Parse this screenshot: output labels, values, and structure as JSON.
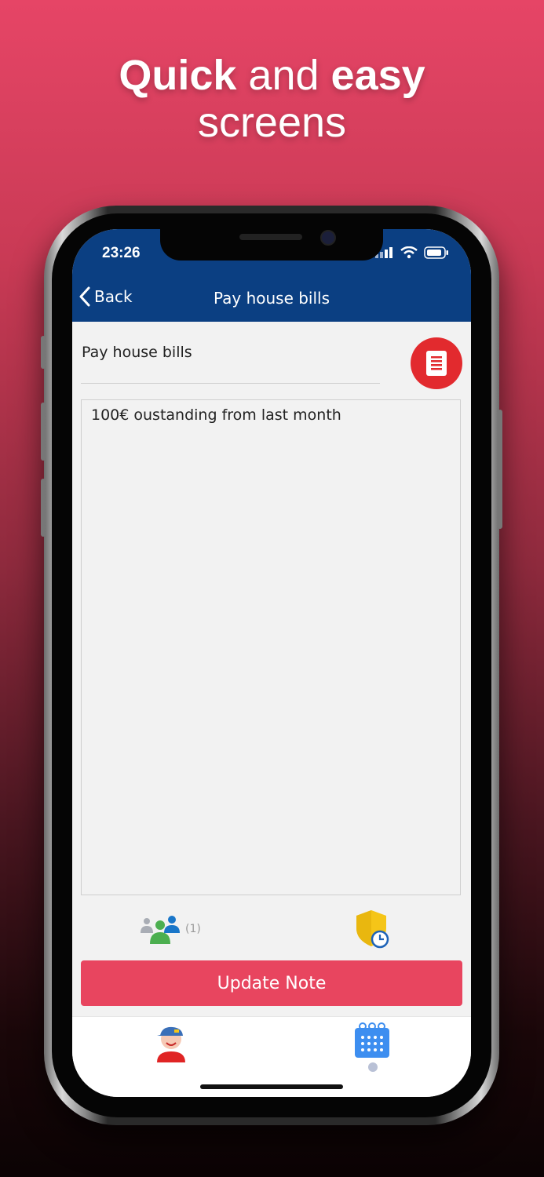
{
  "headline": {
    "line1_bold_a": "Quick",
    "line1_light": "and",
    "line1_bold_b": "easy",
    "line2": "screens"
  },
  "status_bar": {
    "time": "23:26"
  },
  "navbar": {
    "back_label": "Back",
    "title": "Pay house bills"
  },
  "note": {
    "title": "Pay house bills",
    "body": "100€ oustanding from last month",
    "shared_count": "(1)"
  },
  "actions": {
    "update_label": "Update Note"
  },
  "colors": {
    "navbar": "#0b3f82",
    "update_button": "#e8455f",
    "doc_button": "#e22a2e"
  },
  "icons": [
    "chevron-left-icon",
    "document-icon",
    "people-share-icon",
    "shield-clock-icon",
    "user-avatar-icon",
    "calendar-icon",
    "signal-icon",
    "wifi-icon",
    "battery-icon"
  ]
}
